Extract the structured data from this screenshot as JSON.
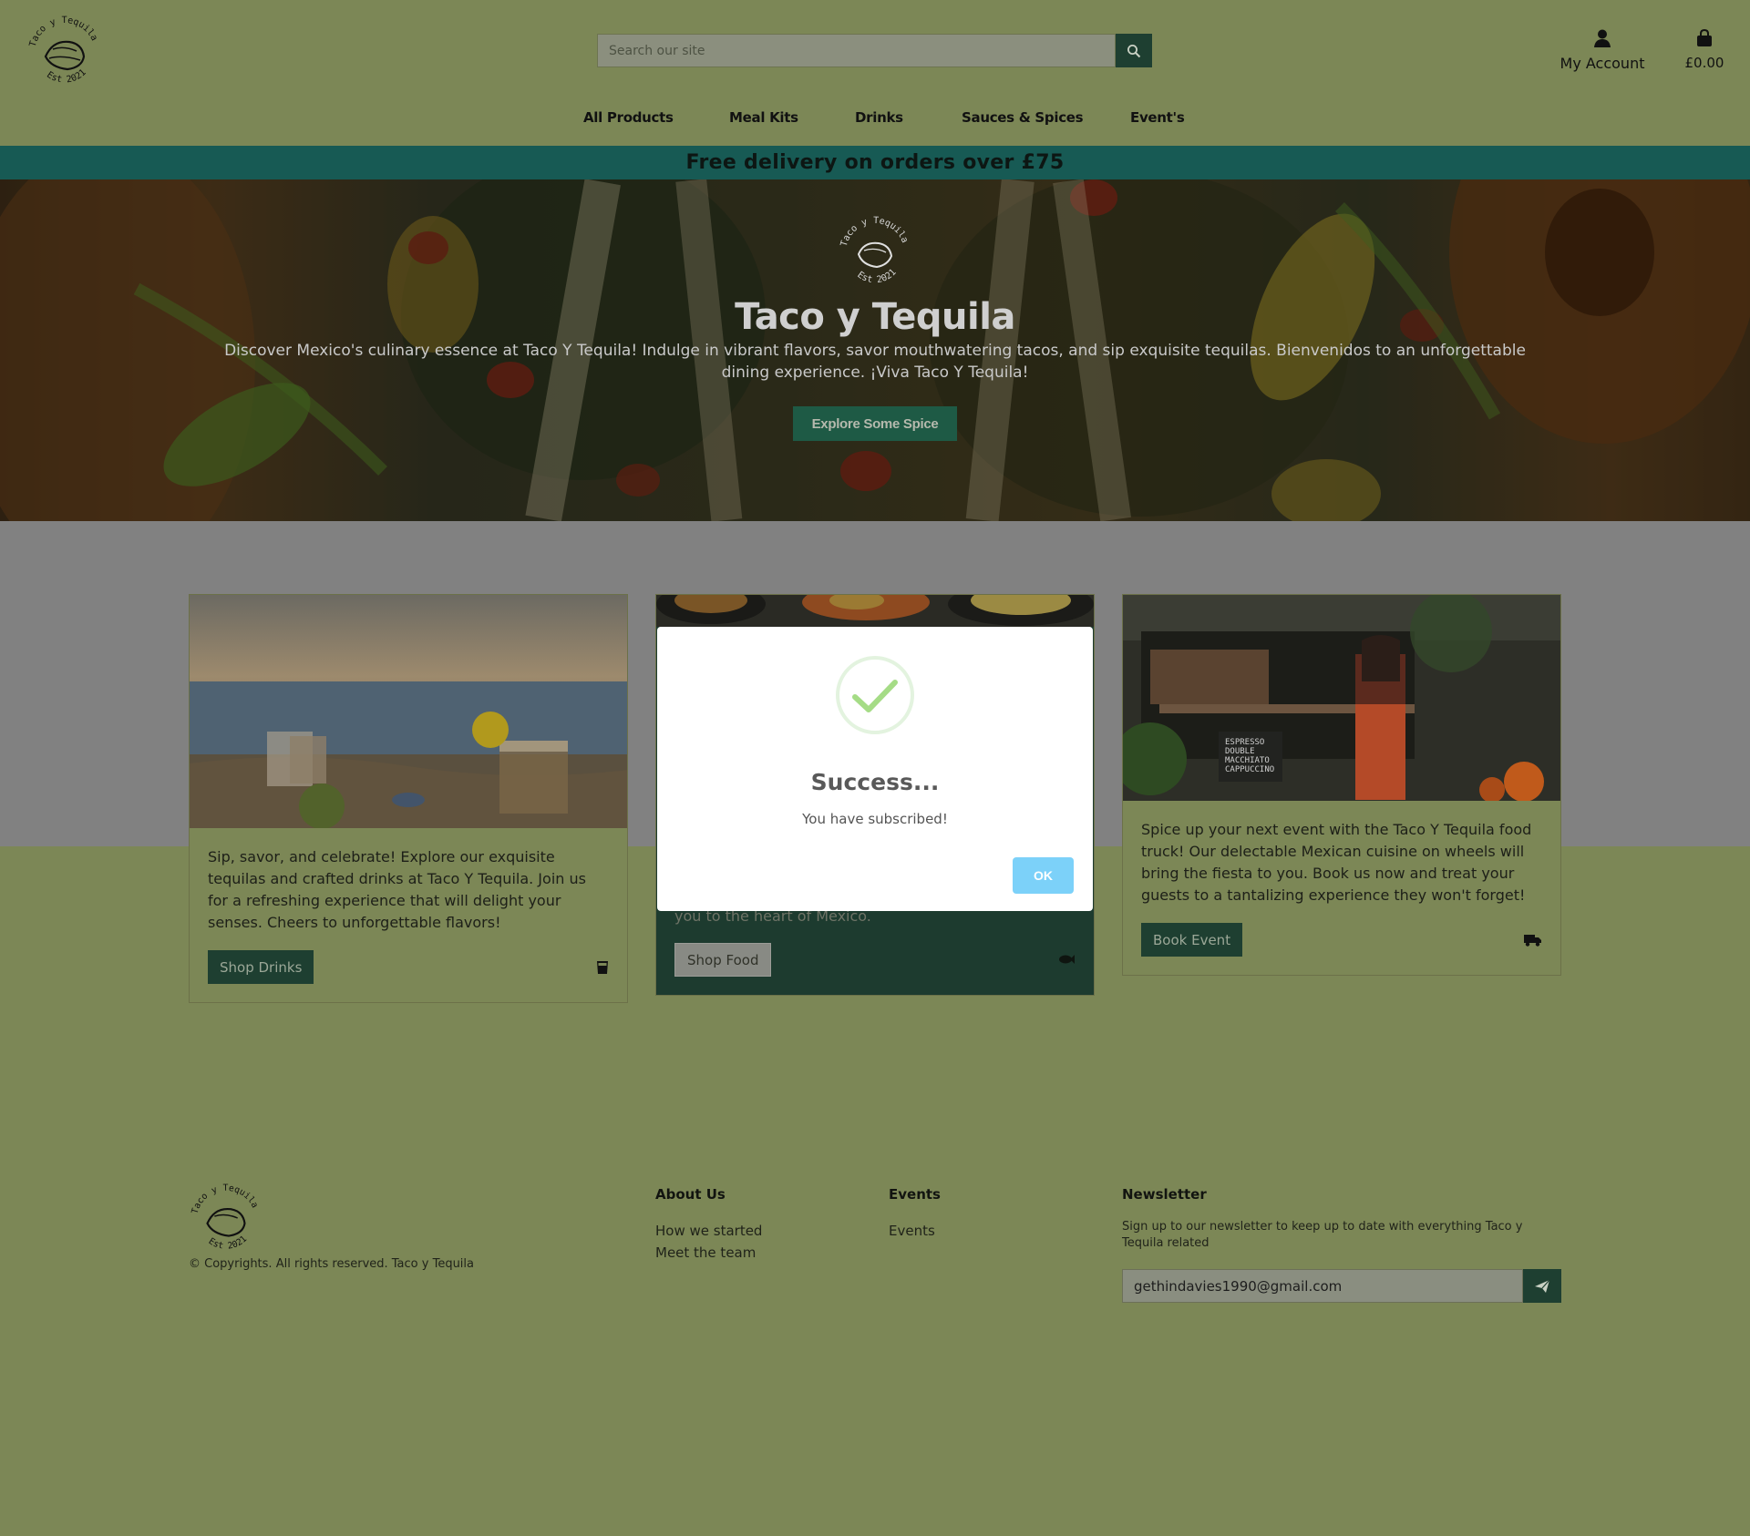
{
  "header": {
    "search_placeholder": "Search our site",
    "account_label": "My Account",
    "bag_total": "£0.00",
    "nav": [
      "All Products",
      "Meal Kits",
      "Drinks",
      "Sauces & Spices",
      "Event's"
    ]
  },
  "banner": "Free delivery on orders over £75",
  "hero": {
    "title": "Taco y Tequila",
    "text": "Discover Mexico's culinary essence at Taco Y Tequila! Indulge in vibrant flavors, savor mouthwatering tacos, and sip exquisite tequilas. Bienvenidos to an unforgettable dining experience. ¡Viva Taco Y Tequila!",
    "button": "Explore Some Spice"
  },
  "cards": [
    {
      "text": "Sip, savor, and celebrate! Explore our exquisite tequilas and crafted drinks at Taco Y Tequila. Join us for a refreshing experience that will delight your senses. Cheers to unforgettable flavors!",
      "button": "Shop Drinks",
      "icon": "glass-icon"
    },
    {
      "text": "you to the heart of Mexico.",
      "button": "Shop Food",
      "icon": "fish-icon"
    },
    {
      "text": "Spice up your next event with the Taco Y Tequila food truck! Our delectable Mexican cuisine on wheels will bring the fiesta to you. Book us now and treat your guests to a tantalizing experience they won't forget!",
      "button": "Book Event",
      "icon": "truck-icon"
    }
  ],
  "footer": {
    "copyright": "© Copyrights. All rights reserved. Taco y Tequila",
    "about_heading": "About Us",
    "about_links": [
      "How we started",
      "Meet the team"
    ],
    "events_heading": "Events",
    "events_links": [
      "Events"
    ],
    "newsletter_heading": "Newsletter",
    "newsletter_text": "Sign up to our newsletter to keep up to date with everything Taco y Tequila related",
    "newsletter_email": "gethindavies1990@gmail.com"
  },
  "modal": {
    "title": "Success...",
    "text": "You have subscribed!",
    "ok": "OK"
  },
  "logo": {
    "top_text": "Taco y Tequila",
    "bottom_text": "Est 2021"
  },
  "colors": {
    "page_bg": "#7c8756",
    "banner_bg": "#175a54",
    "dark_green": "#1e3f31",
    "ok_button": "#7cd1f9"
  }
}
